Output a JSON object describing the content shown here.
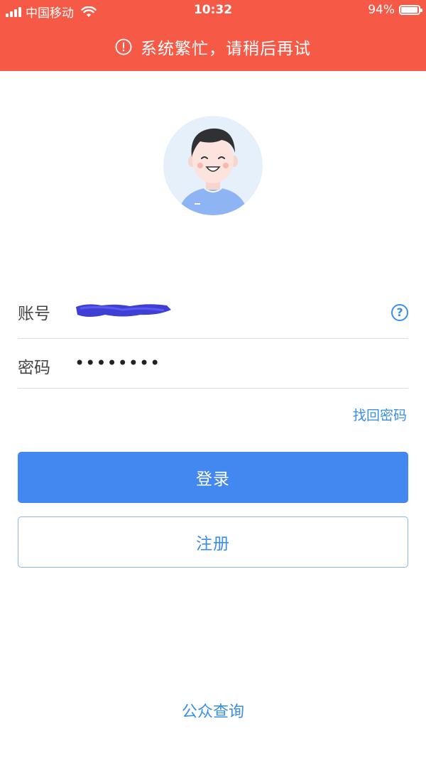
{
  "status_bar": {
    "carrier": "中国移动",
    "time": "10:32",
    "battery_percent": "94%",
    "battery_level": 0.94
  },
  "alert": {
    "message": "系统繁忙，请稍后再试",
    "icon": "exclamation-circle-icon"
  },
  "avatar": {
    "icon": "user-avatar-icon"
  },
  "form": {
    "account_label": "账号",
    "password_label": "密码",
    "password_value": "••••••••",
    "help_icon_text": "?"
  },
  "links": {
    "forgot_password": "找回密码",
    "public_query": "公众查询"
  },
  "buttons": {
    "login": "登录",
    "register": "注册"
  },
  "colors": {
    "alert_bg": "#f65a47",
    "primary": "#4388f0",
    "link": "#3b8ee8"
  }
}
